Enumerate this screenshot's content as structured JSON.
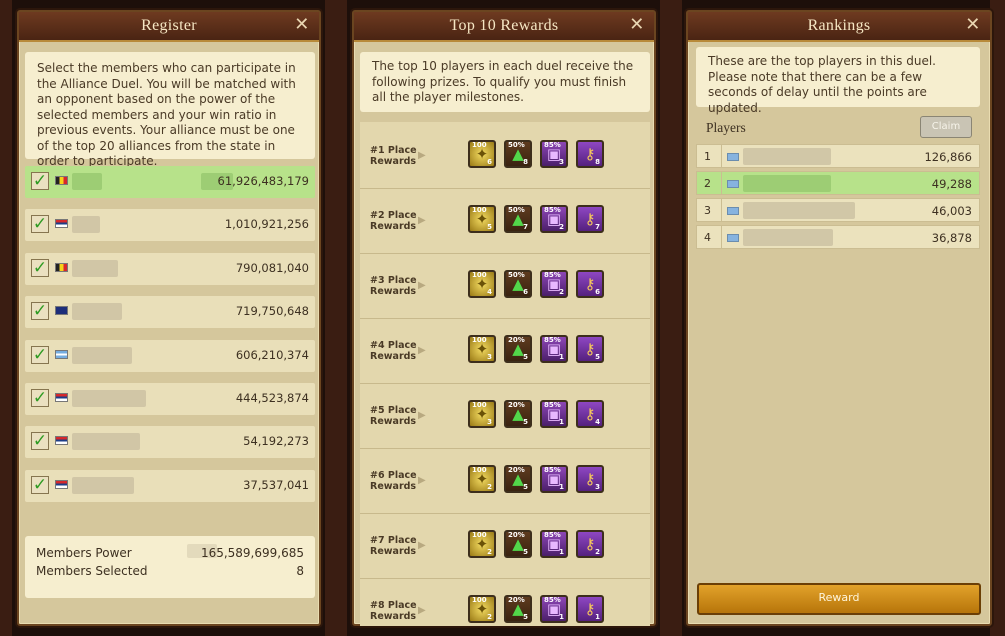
{
  "register": {
    "title": "Register",
    "close": "✕",
    "description": "Select the members who can participate in the Alliance Duel. You will be matched with an opponent based on the power of the selected members and your win ratio in previous events. Your alliance must be one of the top 20 alliances from the state in order to participate.",
    "members": [
      {
        "power": "61,926,483,179",
        "flag": "be",
        "selected": true
      },
      {
        "power": "1,010,921,256",
        "flag": "rs",
        "selected": false
      },
      {
        "power": "790,081,040",
        "flag": "be",
        "selected": false
      },
      {
        "power": "719,750,648",
        "flag": "au",
        "selected": false
      },
      {
        "power": "606,210,374",
        "flag": "ar",
        "selected": false
      },
      {
        "power": "444,523,874",
        "flag": "rs",
        "selected": false
      },
      {
        "power": "54,192,273",
        "flag": "rs",
        "selected": false
      },
      {
        "power": "37,537,041",
        "flag": "rs",
        "selected": false
      }
    ],
    "summary": {
      "power_label": "Members Power",
      "power_value": "165,589,699,685",
      "selected_label": "Members Selected",
      "selected_value": "8"
    }
  },
  "rewards": {
    "title": "Top 10 Rewards",
    "close": "✕",
    "description": "The top 10 players in each duel receive the following prizes. To qualify you must finish all the player milestones.",
    "places": [
      {
        "line1": "#1 Place",
        "line2": "Rewards",
        "items": [
          {
            "icon": "coin-icon",
            "top": "100",
            "bottom": "6"
          },
          {
            "icon": "chest-icon",
            "top": "50%",
            "bottom": "8"
          },
          {
            "icon": "box-icon",
            "top": "85%",
            "bottom": "3"
          },
          {
            "icon": "key-icon",
            "top": "",
            "bottom": "8"
          }
        ]
      },
      {
        "line1": "#2 Place",
        "line2": "Rewards",
        "items": [
          {
            "icon": "coin-icon",
            "top": "100",
            "bottom": "5"
          },
          {
            "icon": "chest-icon",
            "top": "50%",
            "bottom": "7"
          },
          {
            "icon": "box-icon",
            "top": "85%",
            "bottom": "2"
          },
          {
            "icon": "key-icon",
            "top": "",
            "bottom": "7"
          }
        ]
      },
      {
        "line1": "#3 Place",
        "line2": "Rewards",
        "items": [
          {
            "icon": "coin-icon",
            "top": "100",
            "bottom": "4"
          },
          {
            "icon": "chest-icon",
            "top": "50%",
            "bottom": "6"
          },
          {
            "icon": "box-icon",
            "top": "85%",
            "bottom": "2"
          },
          {
            "icon": "key-icon",
            "top": "",
            "bottom": "6"
          }
        ]
      },
      {
        "line1": "#4 Place",
        "line2": "Rewards",
        "items": [
          {
            "icon": "coin-icon",
            "top": "100",
            "bottom": "3"
          },
          {
            "icon": "chest-icon",
            "top": "20%",
            "bottom": "5"
          },
          {
            "icon": "box-icon",
            "top": "85%",
            "bottom": "1"
          },
          {
            "icon": "key-icon",
            "top": "",
            "bottom": "5"
          }
        ]
      },
      {
        "line1": "#5 Place",
        "line2": "Rewards",
        "items": [
          {
            "icon": "coin-icon",
            "top": "100",
            "bottom": "3"
          },
          {
            "icon": "chest-icon",
            "top": "20%",
            "bottom": "5"
          },
          {
            "icon": "box-icon",
            "top": "85%",
            "bottom": "1"
          },
          {
            "icon": "key-icon",
            "top": "",
            "bottom": "4"
          }
        ]
      },
      {
        "line1": "#6 Place",
        "line2": "Rewards",
        "items": [
          {
            "icon": "coin-icon",
            "top": "100",
            "bottom": "2"
          },
          {
            "icon": "chest-icon",
            "top": "20%",
            "bottom": "5"
          },
          {
            "icon": "box-icon",
            "top": "85%",
            "bottom": "1"
          },
          {
            "icon": "key-icon",
            "top": "",
            "bottom": "3"
          }
        ]
      },
      {
        "line1": "#7 Place",
        "line2": "Rewards",
        "items": [
          {
            "icon": "coin-icon",
            "top": "100",
            "bottom": "2"
          },
          {
            "icon": "chest-icon",
            "top": "20%",
            "bottom": "5"
          },
          {
            "icon": "box-icon",
            "top": "85%",
            "bottom": "1"
          },
          {
            "icon": "key-icon",
            "top": "",
            "bottom": "2"
          }
        ]
      },
      {
        "line1": "#8 Place",
        "line2": "Rewards",
        "items": [
          {
            "icon": "coin-icon",
            "top": "100",
            "bottom": "2"
          },
          {
            "icon": "chest-icon",
            "top": "20%",
            "bottom": "5"
          },
          {
            "icon": "box-icon",
            "top": "85%",
            "bottom": "1"
          },
          {
            "icon": "key-icon",
            "top": "",
            "bottom": "1"
          }
        ]
      }
    ]
  },
  "rankings": {
    "title": "Rankings",
    "close": "✕",
    "description": "These are the top players in this duel. Please note that there can be a few seconds of delay until the points are updated.",
    "players_label": "Players",
    "claim_label": "Claim",
    "players": [
      {
        "rank": "1",
        "score": "126,866",
        "selected": false
      },
      {
        "rank": "2",
        "score": "49,288",
        "selected": true
      },
      {
        "rank": "3",
        "score": "46,003",
        "selected": false
      },
      {
        "rank": "4",
        "score": "36,878",
        "selected": false
      }
    ],
    "reward_button": "Reward"
  },
  "colors": {
    "selected_row": "#b7e28a",
    "header": "#5a2c17",
    "reward_button": "#d89418"
  }
}
